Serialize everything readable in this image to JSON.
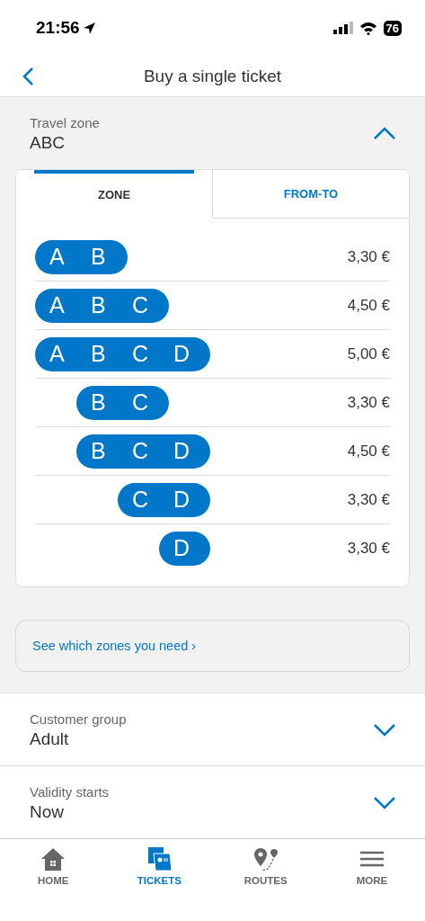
{
  "status_bar": {
    "time": "21:56",
    "battery": "76"
  },
  "header": {
    "title": "Buy a single ticket"
  },
  "travel_zone": {
    "label": "Travel zone",
    "value": "ABC",
    "expanded": true
  },
  "tabs": [
    {
      "label": "ZONE",
      "selected": true
    },
    {
      "label": "FROM-TO",
      "selected": false
    }
  ],
  "zone_rows": [
    {
      "kind": "first",
      "zones": [
        "A",
        "B"
      ],
      "price": "3,30 €"
    },
    {
      "kind": "first",
      "zones": [
        "A",
        "B",
        "C"
      ],
      "price": "4,50 €"
    },
    {
      "kind": "first",
      "zones": [
        "A",
        "B",
        "C",
        "D"
      ],
      "price": "5,00 €"
    },
    {
      "kind": "second",
      "zones": [
        "B",
        "C"
      ],
      "price": "3,30 €"
    },
    {
      "kind": "second",
      "zones": [
        "B",
        "C",
        "D"
      ],
      "price": "4,50 €"
    },
    {
      "kind": "third",
      "zones": [
        "C",
        "D"
      ],
      "price": "3,30 €"
    },
    {
      "kind": "fourth",
      "zones": [
        "D"
      ],
      "price": "3,30 €"
    }
  ],
  "zones_link": "See which zones you need ›",
  "selectors": [
    {
      "label": "Customer group",
      "value": "Adult",
      "expanded": false
    },
    {
      "label": "Validity starts",
      "value": "Now",
      "expanded": false
    }
  ],
  "bottom_nav": [
    {
      "kind": "home",
      "label": "HOME",
      "selected": false
    },
    {
      "kind": "tickets",
      "label": "TICKETS",
      "selected": true
    },
    {
      "kind": "routes",
      "label": "ROUTES",
      "selected": false
    },
    {
      "kind": "more",
      "label": "MORE",
      "selected": false
    }
  ]
}
